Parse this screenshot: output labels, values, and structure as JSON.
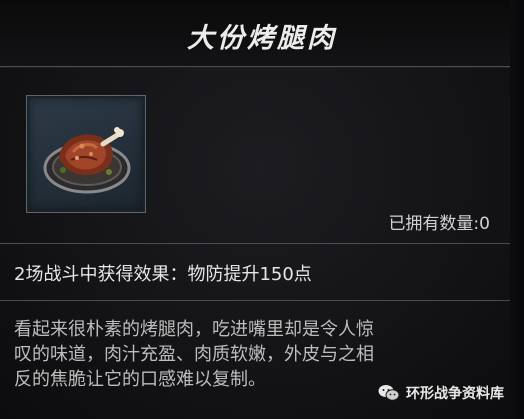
{
  "item": {
    "name": "大份烤腿肉",
    "owned_label": "已拥有数量:",
    "owned_count": "0",
    "effect": "2场战斗中获得效果：物防提升150点",
    "description_lines": [
      "看起来很朴素的烤腿肉，吃进嘴里却是令人惊",
      "叹的味道，肉汁充盈、肉质软嫩，外皮与之相",
      "反的焦脆让它的口感难以复制。"
    ],
    "icon": "roast-meat-on-plate-icon"
  },
  "watermark": {
    "text": "环形战争资料库",
    "icon": "wechat-icon"
  },
  "colors": {
    "background": "#131316",
    "title_text": "#ececec",
    "divider": "#4b4b50",
    "icon_frame": "#2e3a46"
  }
}
